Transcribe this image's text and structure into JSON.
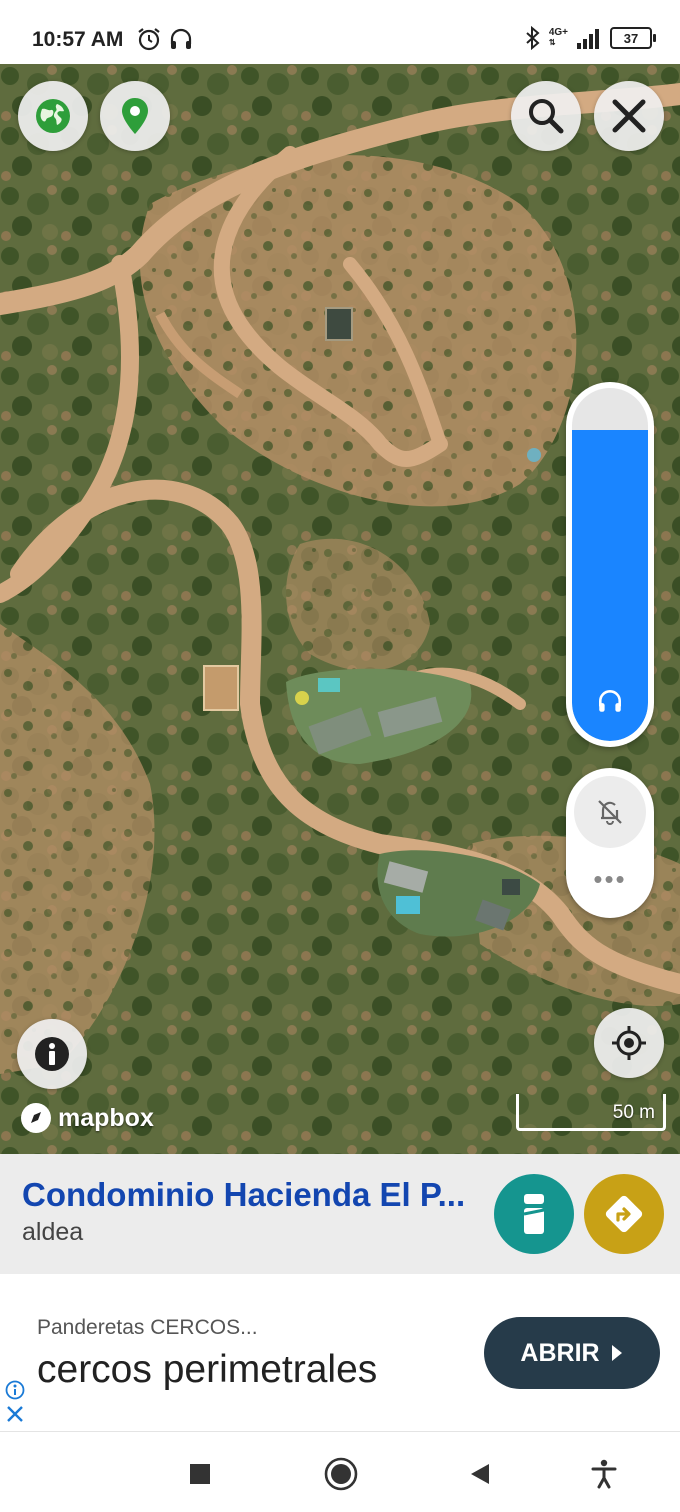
{
  "status_bar": {
    "time": "10:57 AM",
    "network": "4G+",
    "battery": "37",
    "icons": [
      "alarm-icon",
      "headphones-icon",
      "bluetooth-icon",
      "signal-icon",
      "battery-icon"
    ]
  },
  "map": {
    "top_buttons": [
      "globe-icon",
      "map-pin-icon",
      "search-icon",
      "close-icon"
    ],
    "volume_level": 0.88,
    "attribution": "mapbox",
    "scale_label": "50 m",
    "colors": {
      "volume_fill": "#1a85ff",
      "pin": "#2e9e3a"
    }
  },
  "place": {
    "name": "Condominio Hacienda El P...",
    "type": "aldea",
    "colors": {
      "name": "#1346b0",
      "info_button": "#15958f",
      "route_button": "#c8a116"
    }
  },
  "ad": {
    "advertiser": "Panderetas CERCOS...",
    "headline": "cercos perimetrales",
    "cta": "ABRIR"
  },
  "nav_bar": {
    "buttons": [
      "recents-icon",
      "home-icon",
      "back-icon",
      "accessibility-icon"
    ]
  }
}
